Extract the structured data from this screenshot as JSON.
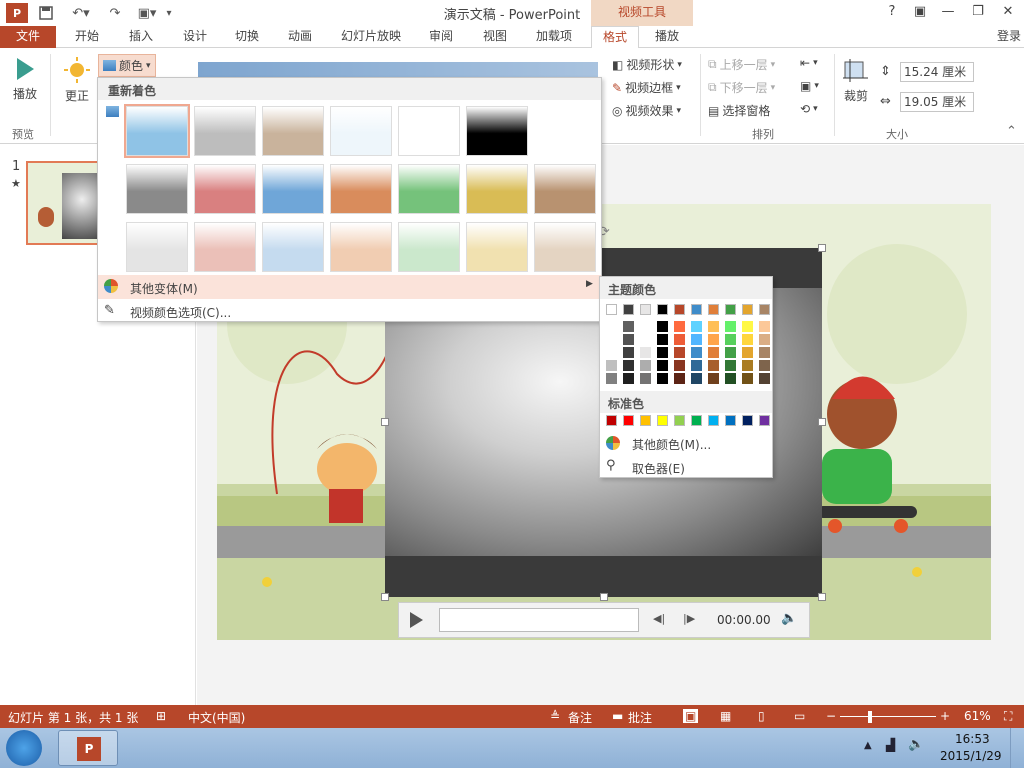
{
  "titlebar": {
    "doc_title": "演示文稿 - PowerPoint",
    "context_tab_group": "视频工具",
    "help": "?",
    "minimize": "—",
    "restore": "❐",
    "close": "✕",
    "login": "登录"
  },
  "tabs": [
    "文件",
    "开始",
    "插入",
    "设计",
    "切换",
    "动画",
    "幻灯片放映",
    "审阅",
    "视图",
    "加载项",
    "格式",
    "播放"
  ],
  "ribbon": {
    "play_label": "播放",
    "correct_label": "更正",
    "color_label": "颜色",
    "preview_group": "预览",
    "video_shape": "视频形状",
    "video_border": "视频边框",
    "video_effects": "视频效果",
    "bring_forward": "上移一层",
    "send_backward": "下移一层",
    "selection_pane": "选择窗格",
    "arrange_group": "排列",
    "crop_label": "裁剪",
    "height_value": "15.24 厘米",
    "width_value": "19.05 厘米",
    "size_group": "大小"
  },
  "color_menu": {
    "recolor_heading": "重新着色",
    "more_variations": "其他变体(M)",
    "video_color_options": "视频颜色选项(C)...",
    "swatch_colors": [
      [
        "#8fc3e6",
        "#bdbdbd",
        "#c9b39c",
        "#eef6fb",
        "#ffffff",
        "#000000"
      ],
      [
        "#8a8a8a",
        "#d98080",
        "#6fa6d8",
        "#d98c5c",
        "#75c27b",
        "#d9bc55",
        "#b89270"
      ],
      [
        "#e4e4e4",
        "#ebc0b8",
        "#c5dbef",
        "#f1cdb2",
        "#cbe8cc",
        "#f1e1b0",
        "#e4d4c2"
      ]
    ]
  },
  "submenu": {
    "theme_colors": "主题颜色",
    "standard_colors": "标准色",
    "more_colors": "其他颜色(M)...",
    "eyedropper": "取色器(E)",
    "theme_top": [
      "#ffffff",
      "#404040",
      "#e7e6e6",
      "#000000",
      "#b7472a",
      "#3f8cc9",
      "#e07f3a",
      "#43a047",
      "#e3a52e",
      "#a88566"
    ],
    "standard": [
      "#c00000",
      "#ff0000",
      "#ffc000",
      "#ffff00",
      "#92d050",
      "#00b050",
      "#00b0f0",
      "#0070c0",
      "#002060",
      "#7030a0"
    ]
  },
  "slide_panel": {
    "number": "1",
    "star": "★"
  },
  "player": {
    "time": "00:00.00"
  },
  "status": {
    "slide_info": "幻灯片 第 1 张，共 1 张",
    "language": "中文(中国)",
    "notes": "备注",
    "comments": "批注",
    "zoom": "61%"
  },
  "taskbar": {
    "time": "16:53",
    "date": "2015/1/29"
  }
}
